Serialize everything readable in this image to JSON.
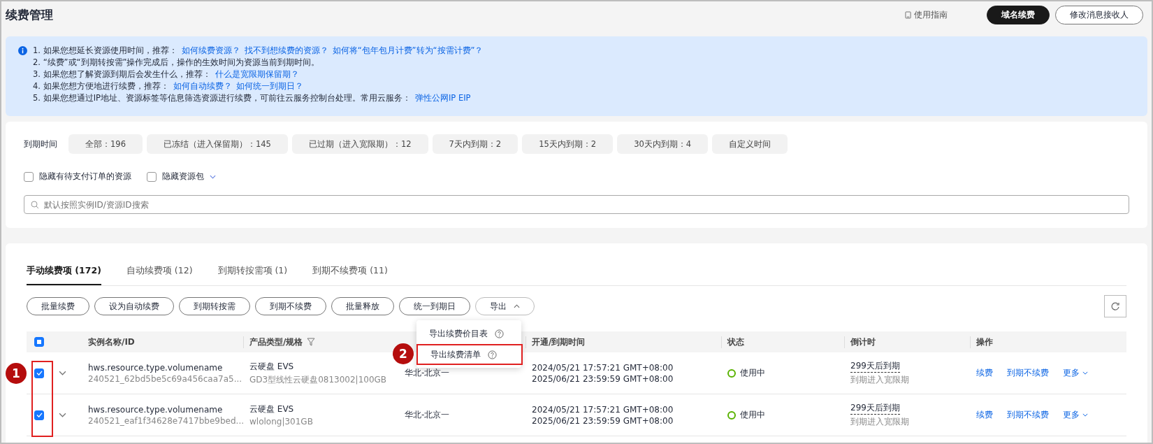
{
  "page": {
    "title": "续费管理",
    "guide_link": "使用指南",
    "buttons": [
      {
        "label": "域名续费",
        "primary": true
      },
      {
        "label": "修改消息接收人",
        "primary": false
      }
    ]
  },
  "notice": {
    "lines": [
      {
        "text": "1. 如果您想延长资源使用时间，推荐：",
        "links": [
          "如何续费资源？",
          "找不到想续费的资源？",
          "如何将“包年包月计费”转为“按需计费”？"
        ]
      },
      {
        "text": "2. “续费”或“到期转按需”操作完成后，操作的生效时间为资源当前到期时间。"
      },
      {
        "text": "3. 如果您想了解资源到期后会发生什么，推荐：",
        "links": [
          "什么是宽限期保留期？"
        ]
      },
      {
        "text": "4. 如果您想方便地进行续费，推荐：",
        "links": [
          "如何自动续费？",
          "如何统一到期日？"
        ]
      },
      {
        "text": "5. 如果您想通过IP地址、资源标签等信息筛选资源进行续费，可前往云服务控制台处理。常用云服务：",
        "links": [
          "弹性公网IP EIP"
        ]
      }
    ]
  },
  "filters": {
    "label": "到期时间",
    "chips": [
      {
        "label": "全部：196",
        "selected": false
      },
      {
        "label": "已冻结（进入保留期）：145",
        "selected": false
      },
      {
        "label": "已过期（进入宽限期）：12",
        "selected": false
      },
      {
        "label": "7天内到期：2",
        "selected": false
      },
      {
        "label": "15天内到期：2",
        "selected": false
      },
      {
        "label": "30天内到期：4",
        "selected": false
      },
      {
        "label": "自定义时间",
        "selected": false
      }
    ],
    "checkboxes": [
      {
        "label": "隐藏有待支付订单的资源",
        "checked": false,
        "kind": "plain"
      },
      {
        "label": "隐藏资源包",
        "checked": false,
        "kind": "dropdown"
      }
    ],
    "search": {
      "placeholder": "默认按照实例ID/资源ID搜索"
    }
  },
  "tabs": [
    {
      "label": "手动续费项 (172)",
      "selected": true
    },
    {
      "label": "自动续费项 (12)",
      "selected": false
    },
    {
      "label": "到期转按需项 (1)",
      "selected": false
    },
    {
      "label": "到期不续费项 (11)",
      "selected": false
    }
  ],
  "actions": [
    {
      "label": "批量续费",
      "kind": "button"
    },
    {
      "label": "设为自动续费",
      "kind": "button"
    },
    {
      "label": "到期转按需",
      "kind": "button"
    },
    {
      "label": "到期不续费",
      "kind": "button"
    },
    {
      "label": "批量释放",
      "kind": "button"
    },
    {
      "label": "统一到期日",
      "kind": "button"
    },
    {
      "label": "导出",
      "kind": "menu",
      "expanded": true
    }
  ],
  "export_menu": [
    {
      "label": "导出续费价目表",
      "highlighted": false
    },
    {
      "label": "导出续费清单",
      "highlighted": true
    }
  ],
  "table": {
    "select_all": {
      "indeterminate": true
    },
    "columns": [
      {
        "label": "实例名称/ID",
        "filter": false
      },
      {
        "label": "产品类型/规格",
        "filter": true
      },
      {
        "label": "开通/到期时间",
        "filter": false
      },
      {
        "label": "状态",
        "filter": false
      },
      {
        "label": "倒计时",
        "filter": false
      },
      {
        "label": "操作",
        "filter": false
      }
    ],
    "rows": [
      {
        "checked": true,
        "name": "hws.resource.type.volumename",
        "id": "240521_62bd5be5c69a456caa7a5...",
        "product": "云硬盘 EVS",
        "spec": "GD3型线性云硬盘0813002|100GB",
        "region": "华北-北京一",
        "start": "2024/05/21 17:57:21 GMT+08:00",
        "end": "2025/06/21 23:59:59 GMT+08:00",
        "status": "使用中",
        "color": "#59b200",
        "countdown": "299天后到期",
        "countdown_note": "到期进入宽限期",
        "actions": [
          "续费",
          "到期不续费",
          "更多"
        ]
      },
      {
        "checked": true,
        "name": "hws.resource.type.volumename",
        "id": "240521_eaf1f34628e7417bbe9bed...",
        "product": "云硬盘 EVS",
        "spec": "wlolong|301GB",
        "region": "华北-北京一",
        "start": "2024/05/21 17:57:21 GMT+08:00",
        "end": "2025/06/21 23:59:59 GMT+08:00",
        "status": "使用中",
        "color": "#59b200",
        "countdown": "299天后到期",
        "countdown_note": "到期进入宽限期",
        "actions": [
          "续费",
          "到期不续费",
          "更多"
        ]
      }
    ]
  },
  "annotations": [
    {
      "label": "1",
      "kind": "framed"
    },
    {
      "label": "2",
      "kind": "plain"
    }
  ]
}
